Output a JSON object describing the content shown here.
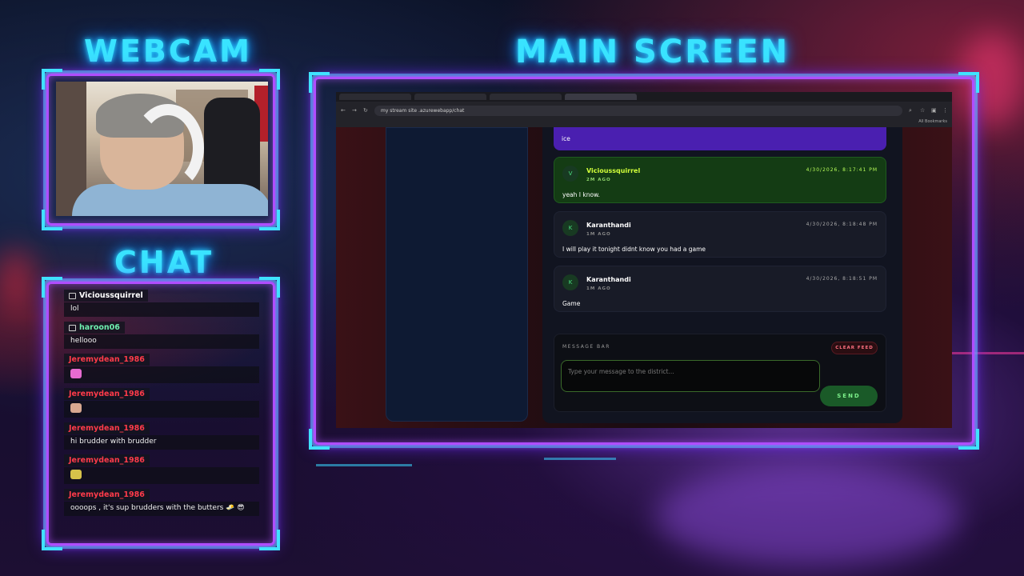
{
  "overlay": {
    "webcam_heading": "WEBCAM",
    "main_heading": "MAIN SCREEN",
    "chat_heading": "CHAT"
  },
  "chat": {
    "messages": [
      {
        "user": "Vicioussquirrel",
        "text": "lol",
        "color": "#ffffff"
      },
      {
        "user": "haroon06",
        "text": "hellooo",
        "color": "#6ff0b0"
      },
      {
        "user": "Jeremydean_1986",
        "text": "",
        "color": "#ff3b4a",
        "emote": "emote-pink"
      },
      {
        "user": "Jeremydean_1986",
        "text": "",
        "color": "#ff3b4a",
        "emote": "emote-figure"
      },
      {
        "user": "Jeremydean_1986",
        "text": "hi brudder with brudder",
        "color": "#ff3b4a"
      },
      {
        "user": "Jeremydean_1986",
        "text": "",
        "color": "#ff3b4a",
        "emote": "emote-sticker"
      },
      {
        "user": "Jeremydean_1986",
        "text": "oooops , it's sup brudders with the butters 🧈 😎",
        "color": "#ff3b4a"
      }
    ]
  },
  "browser": {
    "tabs": [
      "",
      "",
      "",
      ""
    ],
    "url": "my stream site .azurewebapp/chat",
    "bookmarks": "All Bookmarks"
  },
  "feed": {
    "partial_message": "ice",
    "messages": [
      {
        "avatar": "V",
        "author": "Vicioussquirrel",
        "ago": "2M AGO",
        "timestamp": "4/30/2026, 8:17:41 PM",
        "body": "yeah I know."
      },
      {
        "avatar": "K",
        "author": "Karanthandi",
        "ago": "1M AGO",
        "timestamp": "4/30/2026, 8:18:48 PM",
        "body": "I will play it tonight didnt know you had a game"
      },
      {
        "avatar": "K",
        "author": "Karanthandi",
        "ago": "1M AGO",
        "timestamp": "4/30/2026, 8:18:51 PM",
        "body": "Game"
      }
    ],
    "message_bar": {
      "title": "MESSAGE BAR",
      "clear_label": "CLEAR FEED",
      "placeholder": "Type your message to the district...",
      "send_label": "SEND"
    }
  },
  "colors": {
    "neon_cyan": "#39e3ff",
    "neon_purple": "#b04dff",
    "highlight_purple": "#4a1fb0",
    "highlight_green": "#143c14"
  }
}
